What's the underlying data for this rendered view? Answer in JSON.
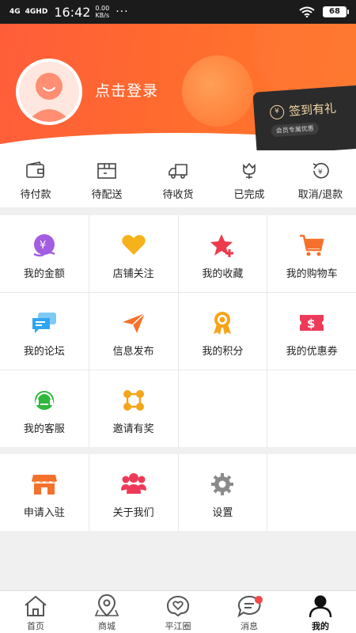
{
  "status_bar": {
    "signal1": "4G",
    "signal2": "4GHD",
    "time": "16:42",
    "speed_value": "0.00",
    "speed_unit": "KB/s",
    "more": "···",
    "battery": "68"
  },
  "header": {
    "login_text": "点击登录",
    "signin_title": "签到有礼",
    "signin_coin": "¥",
    "signin_sub": "会员专属优惠"
  },
  "orders": [
    {
      "label": "待付款",
      "icon": "wallet-icon"
    },
    {
      "label": "待配送",
      "icon": "package-icon"
    },
    {
      "label": "待收货",
      "icon": "truck-icon"
    },
    {
      "label": "已完成",
      "icon": "tulip-icon"
    },
    {
      "label": "取消/退款",
      "icon": "refund-icon"
    }
  ],
  "services": [
    {
      "label": "我的金额",
      "icon": "money-icon",
      "color": "#a25de0"
    },
    {
      "label": "店铺关注",
      "icon": "heart-icon",
      "color": "#f5b21a"
    },
    {
      "label": "我的收藏",
      "icon": "star-icon",
      "color": "#ee3a4a"
    },
    {
      "label": "我的购物车",
      "icon": "cart-icon",
      "color": "#f5712b"
    },
    {
      "label": "我的论坛",
      "icon": "chat-icon",
      "color": "#2fa6f0"
    },
    {
      "label": "信息发布",
      "icon": "send-icon",
      "color": "#f5712b"
    },
    {
      "label": "我的积分",
      "icon": "medal-icon",
      "color": "#f5a51a"
    },
    {
      "label": "我的优惠券",
      "icon": "coupon-icon",
      "color": "#ee3a5a"
    },
    {
      "label": "我的客服",
      "icon": "headset-icon",
      "color": "#2fb83c"
    },
    {
      "label": "邀请有奖",
      "icon": "network-icon",
      "color": "#f5a51a"
    }
  ],
  "settings": [
    {
      "label": "申请入驻",
      "icon": "shop-icon",
      "color": "#f5712b"
    },
    {
      "label": "关于我们",
      "icon": "team-icon",
      "color": "#ee3a5a"
    },
    {
      "label": "设置",
      "icon": "gear-icon",
      "color": "#8a8a8a"
    }
  ],
  "tabbar": [
    {
      "label": "首页",
      "icon": "home-icon"
    },
    {
      "label": "商城",
      "icon": "map-pin-icon"
    },
    {
      "label": "平江圈",
      "icon": "heart-circle-icon"
    },
    {
      "label": "消息",
      "icon": "message-icon"
    },
    {
      "label": "我的",
      "icon": "profile-icon"
    }
  ]
}
